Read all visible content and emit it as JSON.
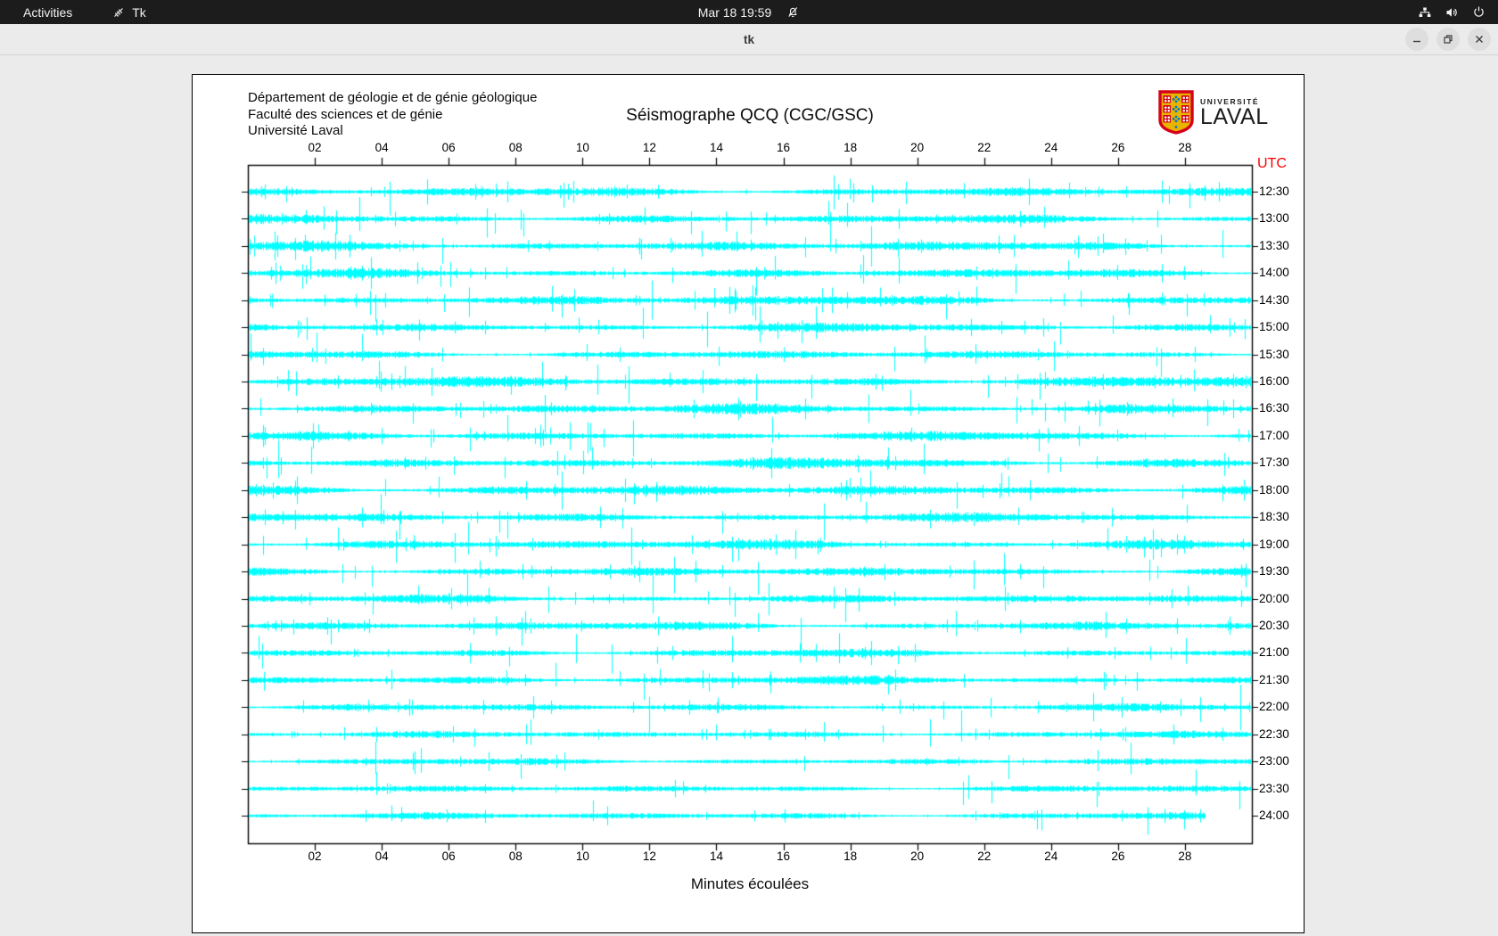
{
  "top_bar": {
    "activities_label": "Activities",
    "app_name": "Tk",
    "clock": "Mar 18 19:59",
    "icons": [
      "notifications-muted",
      "network-wired",
      "volume",
      "power"
    ]
  },
  "window": {
    "title": "tk",
    "controls": [
      "minimize",
      "maximize",
      "close"
    ]
  },
  "logo": {
    "univ": "UNIVERSITÉ",
    "name": "LAVAL"
  },
  "seismograph": {
    "header_lines": "Département de géologie et de génie géologique\nFaculté des sciences et de génie\nUniversité Laval",
    "title": "Séismographe QCQ (CGC/GSC)",
    "utc_label": "UTC",
    "xlabel": "Minutes écoulées",
    "x_range_minutes": [
      0,
      30
    ],
    "x_tick_minutes": [
      2,
      4,
      6,
      8,
      10,
      12,
      14,
      16,
      18,
      20,
      22,
      24,
      26,
      28
    ],
    "x_tick_labels": [
      "02",
      "04",
      "06",
      "08",
      "10",
      "12",
      "14",
      "16",
      "18",
      "20",
      "22",
      "24",
      "26",
      "28"
    ],
    "trace_color": "#00ffff",
    "axis_color": "#000000",
    "utc_color": "#fa0000",
    "rows": [
      {
        "label": "12:30",
        "seed": 3101,
        "noise": 2.4,
        "spikes": 16,
        "end": 1
      },
      {
        "label": "13:00",
        "seed": 3102,
        "noise": 2.3,
        "spikes": 18,
        "end": 1
      },
      {
        "label": "13:30",
        "seed": 3103,
        "noise": 2.6,
        "spikes": 20,
        "end": 1
      },
      {
        "label": "14:00",
        "seed": 3104,
        "noise": 2.4,
        "spikes": 18,
        "end": 1
      },
      {
        "label": "14:30",
        "seed": 3105,
        "noise": 2.7,
        "spikes": 22,
        "end": 1
      },
      {
        "label": "15:00",
        "seed": 3106,
        "noise": 2.3,
        "spikes": 16,
        "end": 1
      },
      {
        "label": "15:30",
        "seed": 3107,
        "noise": 2.2,
        "spikes": 15,
        "end": 1
      },
      {
        "label": "16:00",
        "seed": 3108,
        "noise": 2.8,
        "spikes": 20,
        "end": 1
      },
      {
        "label": "16:30",
        "seed": 3109,
        "noise": 2.7,
        "spikes": 19,
        "end": 1
      },
      {
        "label": "17:00",
        "seed": 3110,
        "noise": 2.4,
        "spikes": 17,
        "end": 1
      },
      {
        "label": "17:30",
        "seed": 3111,
        "noise": 2.8,
        "spikes": 21,
        "end": 1
      },
      {
        "label": "18:00",
        "seed": 3112,
        "noise": 2.9,
        "spikes": 20,
        "end": 1
      },
      {
        "label": "18:30",
        "seed": 3113,
        "noise": 2.4,
        "spikes": 16,
        "end": 1
      },
      {
        "label": "19:00",
        "seed": 3114,
        "noise": 2.6,
        "spikes": 20,
        "end": 1
      },
      {
        "label": "19:30",
        "seed": 3115,
        "noise": 2.4,
        "spikes": 16,
        "end": 1
      },
      {
        "label": "20:00",
        "seed": 3116,
        "noise": 2.2,
        "spikes": 15,
        "end": 1
      },
      {
        "label": "20:30",
        "seed": 3117,
        "noise": 2.3,
        "spikes": 14,
        "end": 1
      },
      {
        "label": "21:00",
        "seed": 3118,
        "noise": 2.1,
        "spikes": 13,
        "end": 1
      },
      {
        "label": "21:30",
        "seed": 3119,
        "noise": 2.2,
        "spikes": 14,
        "end": 1
      },
      {
        "label": "22:00",
        "seed": 3120,
        "noise": 1.9,
        "spikes": 11,
        "end": 1
      },
      {
        "label": "22:30",
        "seed": 3121,
        "noise": 1.8,
        "spikes": 10,
        "end": 1
      },
      {
        "label": "23:00",
        "seed": 3122,
        "noise": 1.7,
        "spikes": 9,
        "end": 1
      },
      {
        "label": "23:30",
        "seed": 3123,
        "noise": 1.7,
        "spikes": 9,
        "end": 1
      },
      {
        "label": "24:00",
        "seed": 3124,
        "noise": 1.8,
        "spikes": 8,
        "end": 0.955
      }
    ]
  }
}
